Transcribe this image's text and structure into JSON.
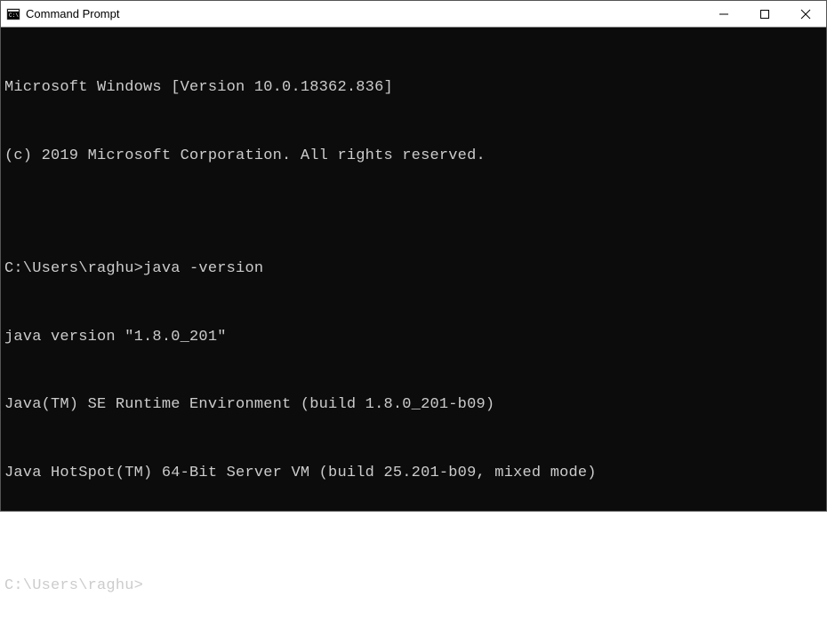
{
  "window": {
    "title": "Command Prompt"
  },
  "terminal": {
    "lines": [
      "Microsoft Windows [Version 10.0.18362.836]",
      "(c) 2019 Microsoft Corporation. All rights reserved.",
      "",
      "C:\\Users\\raghu>java -version",
      "java version \"1.8.0_201\"",
      "Java(TM) SE Runtime Environment (build 1.8.0_201-b09)",
      "Java HotSpot(TM) 64-Bit Server VM (build 25.201-b09, mixed mode)",
      "",
      "C:\\Users\\raghu>"
    ]
  }
}
